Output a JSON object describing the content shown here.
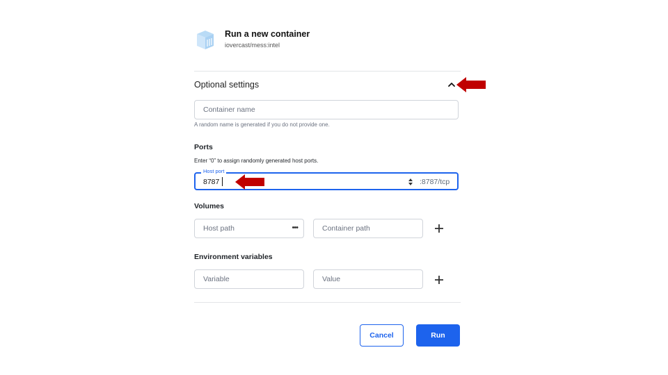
{
  "header": {
    "title": "Run a new container",
    "image_name": "iovercast/mess:intel"
  },
  "optional_settings": {
    "label": "Optional settings",
    "expanded": true
  },
  "container_name": {
    "placeholder": "Container name",
    "value": "",
    "help": "A random name is generated if you do not provide one."
  },
  "ports": {
    "heading": "Ports",
    "help": "Enter “0” to assign randomly generated host ports.",
    "host_port_label": "Host port",
    "host_port_value": "8787",
    "container_port": ":8787/tcp"
  },
  "volumes": {
    "heading": "Volumes",
    "host_path_placeholder": "Host path",
    "container_path_placeholder": "Container path",
    "browse_glyph": "•••"
  },
  "env": {
    "heading": "Environment variables",
    "variable_placeholder": "Variable",
    "value_placeholder": "Value"
  },
  "actions": {
    "cancel_label": "Cancel",
    "run_label": "Run"
  },
  "colors": {
    "accent": "#1d63ed",
    "annotation_arrow": "#c00000"
  }
}
